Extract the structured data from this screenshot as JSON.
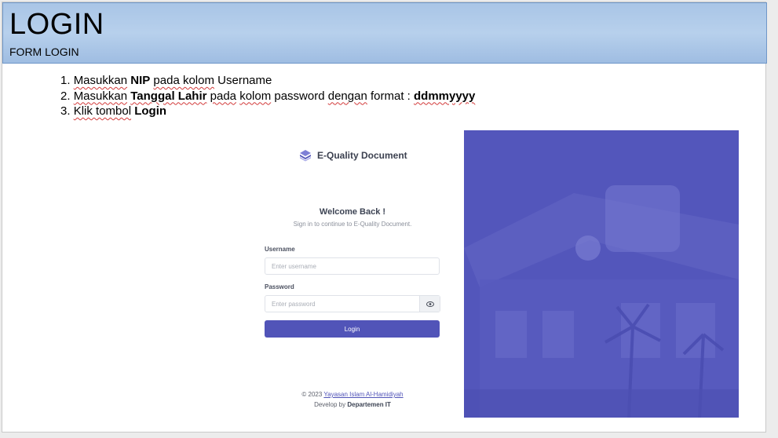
{
  "header": {
    "title": "LOGIN",
    "subtitle": "FORM LOGIN"
  },
  "steps": [
    {
      "num": "1.",
      "parts": [
        {
          "t": "Masukkan",
          "sq": true
        },
        {
          "t": " "
        },
        {
          "t": "NIP",
          "b": true
        },
        {
          "t": " "
        },
        {
          "t": "pada kolom",
          "sq": true
        },
        {
          "t": " Username"
        }
      ]
    },
    {
      "num": "2.",
      "parts": [
        {
          "t": "Masukkan",
          "sq": true
        },
        {
          "t": " "
        },
        {
          "t": "Tanggal Lahir",
          "b": true,
          "sq": true
        },
        {
          "t": " "
        },
        {
          "t": "pada",
          "sq": true
        },
        {
          "t": " "
        },
        {
          "t": "kolom",
          "sq": true
        },
        {
          "t": " password "
        },
        {
          "t": "dengan",
          "sq": true
        },
        {
          "t": " format : "
        },
        {
          "t": "ddmmyyyy",
          "b": true,
          "sq": true
        }
      ]
    },
    {
      "num": "3.",
      "parts": [
        {
          "t": "Klik tombol",
          "sq": true
        },
        {
          "t": " "
        },
        {
          "t": "Login",
          "b": true
        }
      ]
    }
  ],
  "login": {
    "brand": "E-Quality Document",
    "welcome": "Welcome Back !",
    "subtitle": "Sign in to continue to E-Quality Document.",
    "username_label": "Username",
    "username_placeholder": "Enter username",
    "password_label": "Password",
    "password_placeholder": "Enter password",
    "button": "Login",
    "footer_prefix": "© 2023",
    "footer_link": "Yayasan Islam Al-Hamidiyah",
    "footer_develop": "Develop by",
    "footer_dept": "Departemen IT"
  },
  "colors": {
    "accent": "#5154b8",
    "hero": "#5356bb",
    "header_bg": "#b7d0ec"
  },
  "icons": {
    "brand": "layers-icon",
    "password_toggle": "eye-icon"
  }
}
